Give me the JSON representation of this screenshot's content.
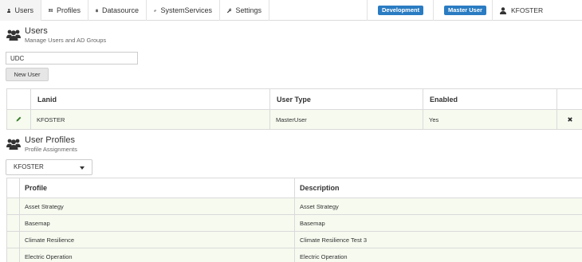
{
  "nav": {
    "tabs": [
      {
        "label": "Users",
        "icon": "user-icon"
      },
      {
        "label": "Profiles",
        "icon": "id-card-icon"
      },
      {
        "label": "Datasource",
        "icon": "database-icon"
      },
      {
        "label": "SystemServices",
        "icon": "gears-icon"
      },
      {
        "label": "Settings",
        "icon": "wrench-icon"
      }
    ],
    "environment_badge": "Development",
    "role_badge": "Master User",
    "current_user": "KFOSTER",
    "badge_color": "#2a7cc2"
  },
  "users_section": {
    "title": "Users",
    "subtitle": "Manage Users and AD Groups",
    "search_value": "UDC",
    "new_user_label": "New User",
    "columns": [
      "Lanid",
      "User Type",
      "Enabled"
    ],
    "rows": [
      {
        "lanid": "KFOSTER",
        "user_type": "MasterUser",
        "enabled": "Yes"
      }
    ]
  },
  "profiles_section": {
    "title": "User Profiles",
    "subtitle": "Profile Assignments",
    "selected_user": "KFOSTER",
    "columns": [
      "Profile",
      "Description"
    ],
    "rows": [
      {
        "profile": "Asset Strategy",
        "description": "Asset Strategy"
      },
      {
        "profile": "Basemap",
        "description": "Basemap"
      },
      {
        "profile": "Climate Resilience",
        "description": "Climate Resilience Test 3"
      },
      {
        "profile": "Electric Operation",
        "description": "Electric Operation"
      }
    ]
  },
  "colors": {
    "row_highlight": "#f6faef",
    "edit_icon": "#3a7d2c"
  }
}
